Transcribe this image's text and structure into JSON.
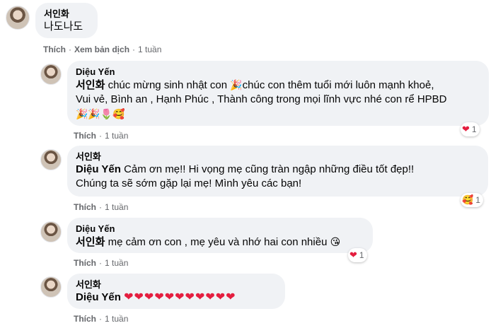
{
  "labels": {
    "like": "Thích",
    "see_translation": "Xem bản dịch",
    "time": "1 tuần",
    "sep": "·"
  },
  "comments": [
    {
      "author": "서인화",
      "text": "나도나도",
      "avatar_icon": "user-photo"
    },
    {
      "author": "Diệu Yến",
      "tag": "서인화",
      "text1": "chúc mừng sinh nhật con",
      "emoji1": "🎉",
      "text2": "chúc con thêm tuổi mới luôn mạnh khoẻ,",
      "line2": "Vui vẻ, Bình an , Hạnh Phúc , Thành công trong mọi lĩnh vực nhé con rể HPBD",
      "emoji_line": "🎉🎉🌷🥰",
      "reaction_icon": "❤",
      "reaction_count": "1"
    },
    {
      "author": "서인화",
      "tag": "Diệu Yến",
      "text1": "Cảm ơn mẹ!! Hi vọng mẹ cũng tràn ngập những điều tốt đẹp!!",
      "line2": "Chúng ta sẽ sớm gặp lại mẹ! Mình yêu các bạn!",
      "reaction_icon": "🥰",
      "reaction_count": "1"
    },
    {
      "author": "Diệu Yến",
      "tag": "서인화",
      "text1": "mẹ cảm ơn con , mẹ yêu và nhớ hai con nhiều",
      "emoji1": "😘",
      "reaction_icon": "❤",
      "reaction_count": "1"
    },
    {
      "author": "서인화",
      "tag": "Diệu Yến",
      "hearts": "❤❤❤❤❤❤❤❤❤❤❤"
    }
  ],
  "colors": {
    "bubble": "#f0f2f5",
    "meta": "#65676b",
    "heart": "#e41e3f"
  }
}
